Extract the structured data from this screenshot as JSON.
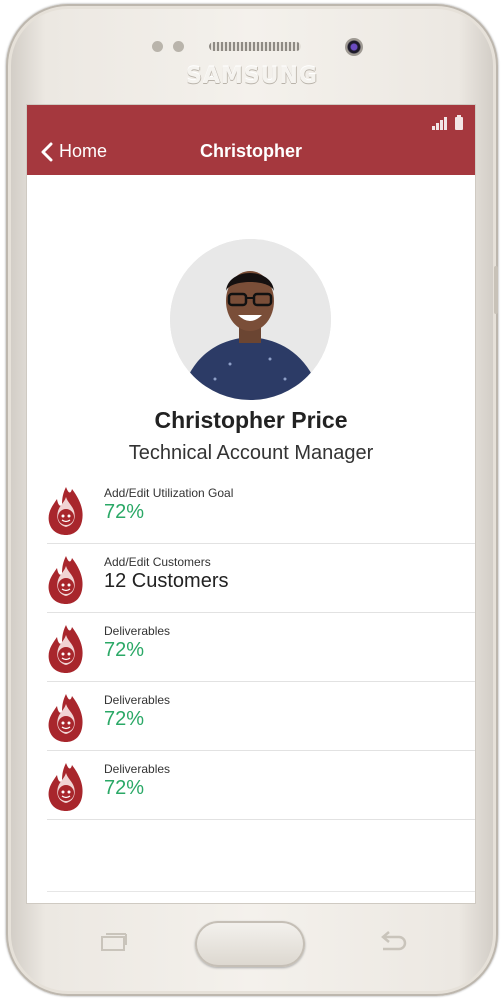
{
  "device": {
    "brand": "SAMSUNG"
  },
  "header": {
    "back_label": "Home",
    "title": "Christopher"
  },
  "profile": {
    "name": "Christopher Price",
    "role": "Technical Account Manager"
  },
  "items": [
    {
      "label": "Add/Edit Utilization Goal",
      "value": "72%",
      "value_color": "#2aa866"
    },
    {
      "label": "Add/Edit Customers",
      "value": "12 Customers",
      "value_color": "#222222"
    },
    {
      "label": "Deliverables",
      "value": "72%",
      "value_color": "#2aa866"
    },
    {
      "label": "Deliverables",
      "value": "72%",
      "value_color": "#2aa866"
    },
    {
      "label": "Deliverables",
      "value": "72%",
      "value_color": "#2aa866"
    }
  ],
  "colors": {
    "appbar": "#a5383e",
    "flame": "#a8262c",
    "accent_green": "#2aa866"
  },
  "icons": [
    "chevron-left-icon",
    "signal-icon",
    "battery-icon",
    "flame-icon",
    "recent-apps-icon",
    "back-arrow-icon"
  ]
}
